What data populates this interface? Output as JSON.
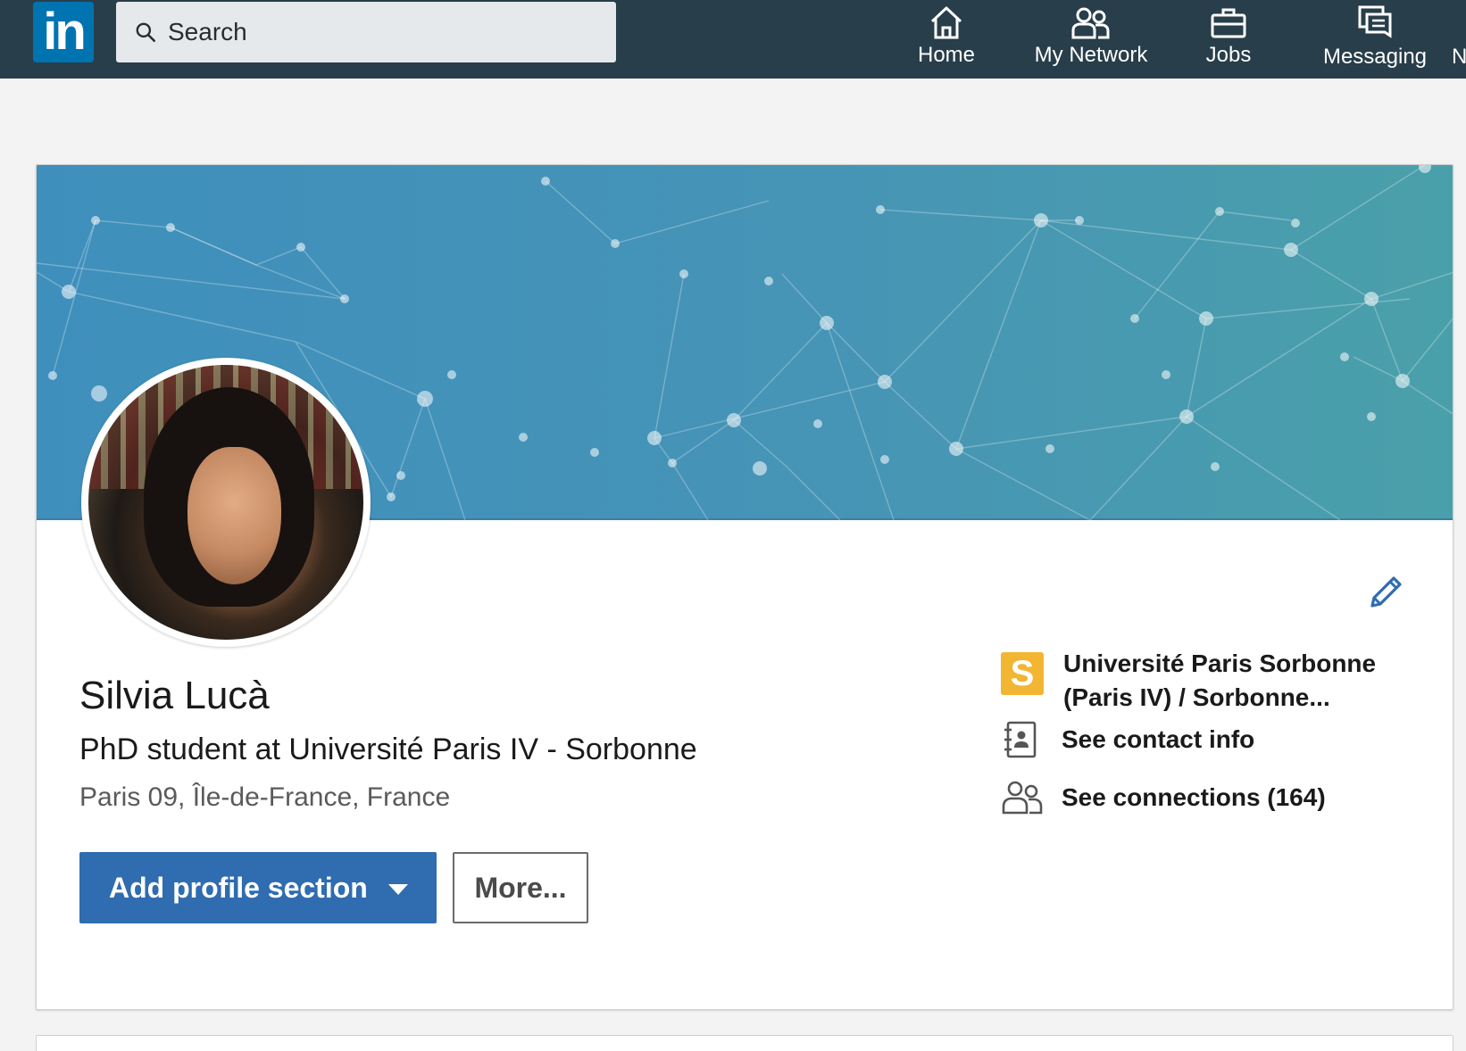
{
  "nav": {
    "logo_text": "in",
    "search_placeholder": "Search",
    "items": [
      {
        "label": "Home",
        "icon": "home-icon"
      },
      {
        "label": "My Network",
        "icon": "network-icon"
      },
      {
        "label": "Jobs",
        "icon": "briefcase-icon"
      },
      {
        "label": "Messaging",
        "icon": "messaging-icon"
      },
      {
        "label": "N",
        "icon": ""
      }
    ]
  },
  "profile": {
    "name": "Silvia Lucà",
    "headline": "PhD student at Université Paris IV - Sorbonne",
    "location": "Paris 09, Île-de-France, France",
    "add_section_label": "Add profile section",
    "more_label": "More...",
    "school_logo_text": "S",
    "school_line1": "Université Paris Sorbonne",
    "school_line2": "(Paris IV) / Sorbonne...",
    "contact_label": "See contact info",
    "connections_label": "See connections (164)"
  },
  "colors": {
    "nav_bg": "#283e4a",
    "brand_blue": "#0073b1",
    "primary_button": "#2f6cb0",
    "school_logo_bg": "#f2b632"
  }
}
